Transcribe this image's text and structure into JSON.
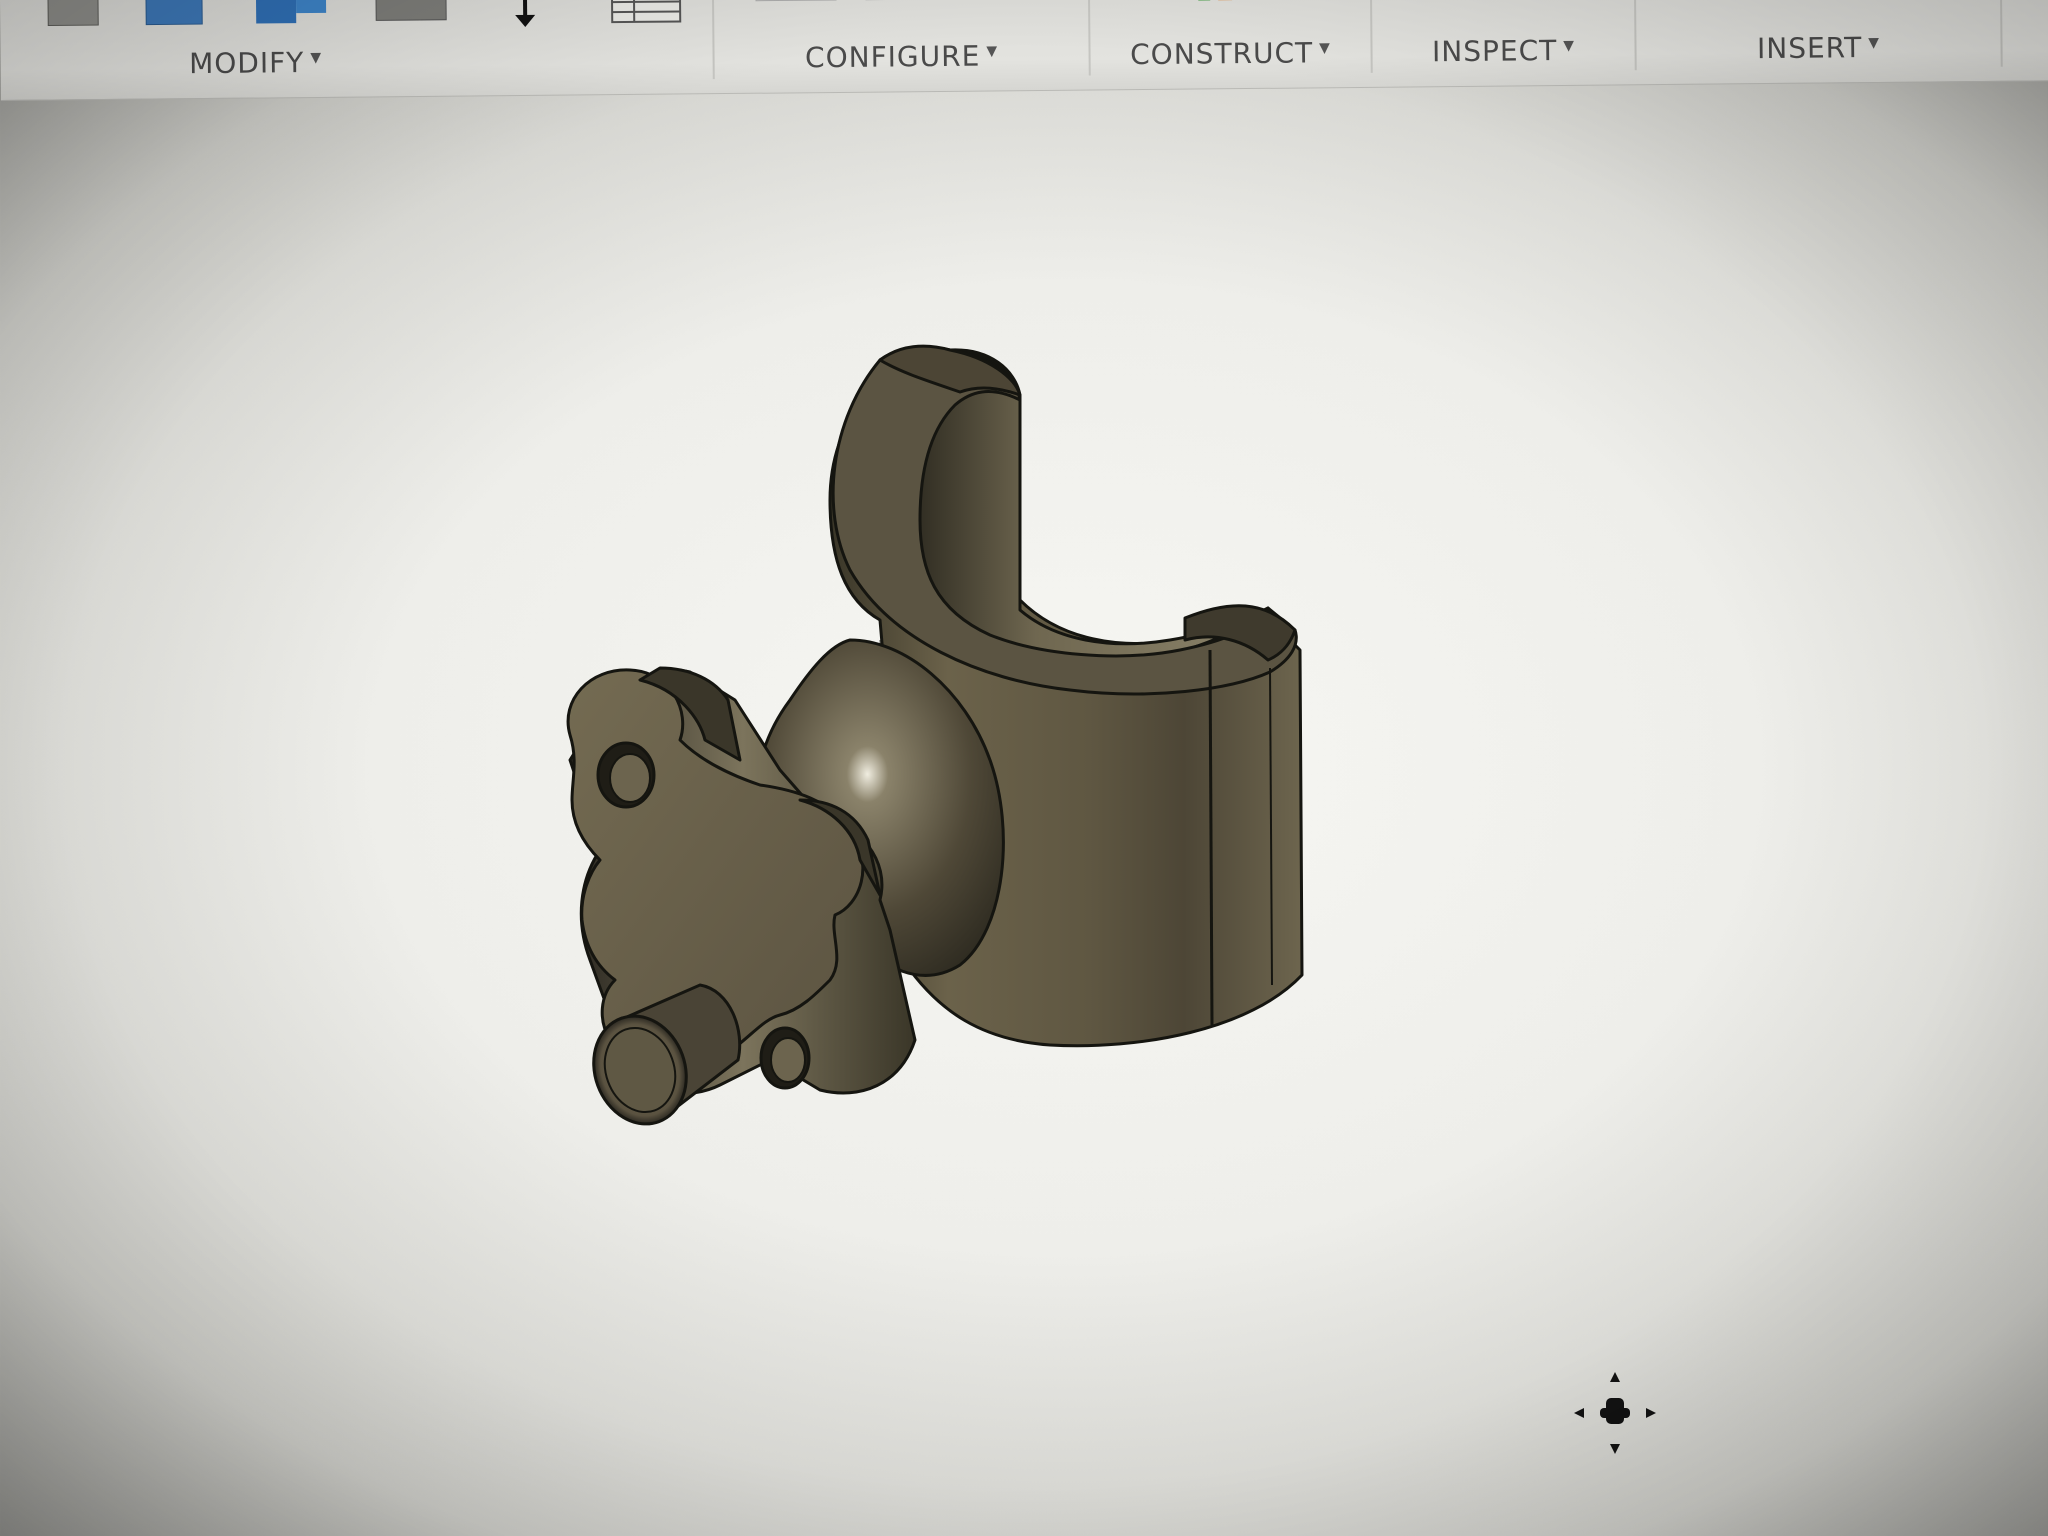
{
  "toolbar": {
    "groups": [
      {
        "label": "MODIFY"
      },
      {
        "label": "CONFIGURE"
      },
      {
        "label": "CONSTRUCT"
      },
      {
        "label": "INSPECT"
      },
      {
        "label": "INSERT"
      }
    ]
  },
  "icons": {
    "modify_1": "push-pull-icon",
    "modify_2": "fillet-icon",
    "modify_3": "combine-icon",
    "modify_4": "shell-icon",
    "modify_5": "move-icon",
    "modify_6": "parameters-table-icon",
    "configure_1": "configure-table-icon",
    "construct_1": "plane-icon",
    "inspect_1": "measure-icon",
    "insert_1": "insert-icon",
    "viewport_cursor": "pan-move-cursor-icon"
  },
  "colors": {
    "model_base": "#6b624a",
    "model_highlight": "#a59d86",
    "model_shadow": "#2c291f",
    "edge": "#151510"
  }
}
